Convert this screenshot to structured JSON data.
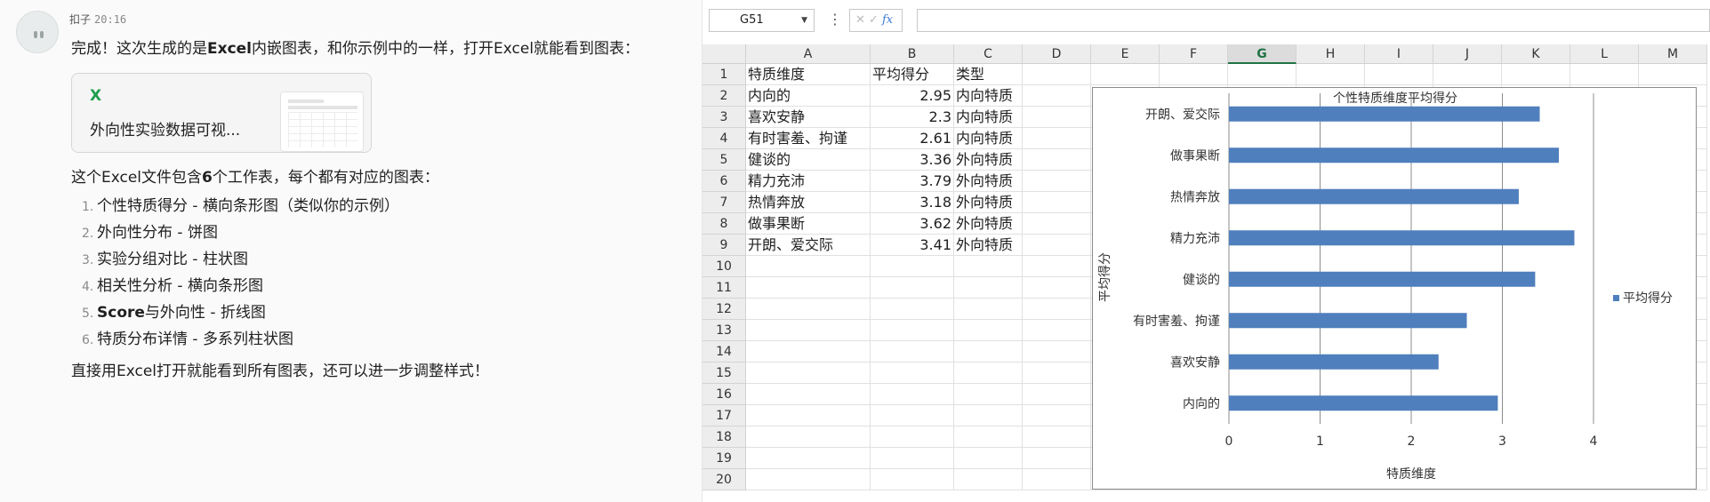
{
  "chat": {
    "sender": "扣子",
    "time": "20:16",
    "intro_prefix": "完成！这次生成的是",
    "intro_bold": "Excel",
    "intro_suffix": "内嵌图表，和你示例中的一样，打开Excel就能看到图表：",
    "file": {
      "icon": "X",
      "name": "外向性实验数据可视..."
    },
    "summary_prefix": "这个Excel文件包含",
    "summary_bold": "6",
    "summary_suffix": "个工作表，每个都有对应的图表：",
    "items": [
      {
        "num": "1.",
        "text": "个性特质得分 - 横向条形图（类似你的示例）"
      },
      {
        "num": "2.",
        "text": "外向性分布 - 饼图"
      },
      {
        "num": "3.",
        "text": "实验分组对比 - 柱状图"
      },
      {
        "num": "4.",
        "text": "相关性分析 - 横向条形图"
      },
      {
        "num": "5.",
        "bold": "Score",
        "text": "与外向性 - 折线图"
      },
      {
        "num": "6.",
        "text": "特质分布详情 - 多系列柱状图"
      }
    ],
    "closing": "直接用Excel打开就能看到所有图表，还可以进一步调整样式！"
  },
  "excel": {
    "name_box": "G51",
    "columns": [
      "A",
      "B",
      "C",
      "D",
      "E",
      "F",
      "G",
      "H",
      "I",
      "J",
      "K",
      "L",
      "M"
    ],
    "selected_column": "G",
    "row_numbers": [
      "1",
      "2",
      "3",
      "4",
      "5",
      "6",
      "7",
      "8",
      "9",
      "10",
      "11",
      "12",
      "13",
      "14",
      "15",
      "16",
      "17",
      "18",
      "19",
      "20"
    ],
    "headers": [
      "特质维度",
      "平均得分",
      "类型"
    ],
    "rows": [
      [
        "内向的",
        "2.95",
        "内向特质"
      ],
      [
        "喜欢安静",
        "2.3",
        "内向特质"
      ],
      [
        "有时害羞、拘谨",
        "2.61",
        "内向特质"
      ],
      [
        "健谈的",
        "3.36",
        "外向特质"
      ],
      [
        "精力充沛",
        "3.79",
        "外向特质"
      ],
      [
        "热情奔放",
        "3.18",
        "外向特质"
      ],
      [
        "做事果断",
        "3.62",
        "外向特质"
      ],
      [
        "开朗、爱交际",
        "3.41",
        "外向特质"
      ]
    ]
  },
  "chart_data": {
    "type": "bar",
    "orientation": "horizontal",
    "title": "个性特质维度平均得分",
    "xlabel": "特质维度",
    "ylabel": "平均得分",
    "categories": [
      "内向的",
      "喜欢安静",
      "有时害羞、拘谨",
      "健谈的",
      "精力充沛",
      "热情奔放",
      "做事果断",
      "开朗、爱交际"
    ],
    "series": [
      {
        "name": "平均得分",
        "values": [
          2.95,
          2.3,
          2.61,
          3.36,
          3.79,
          3.18,
          3.62,
          3.41
        ],
        "color": "#4f7fbd"
      }
    ],
    "xlim": [
      0,
      4
    ],
    "ticks": [
      "0",
      "1",
      "2",
      "3",
      "4"
    ],
    "grid": true,
    "legend": "right"
  }
}
